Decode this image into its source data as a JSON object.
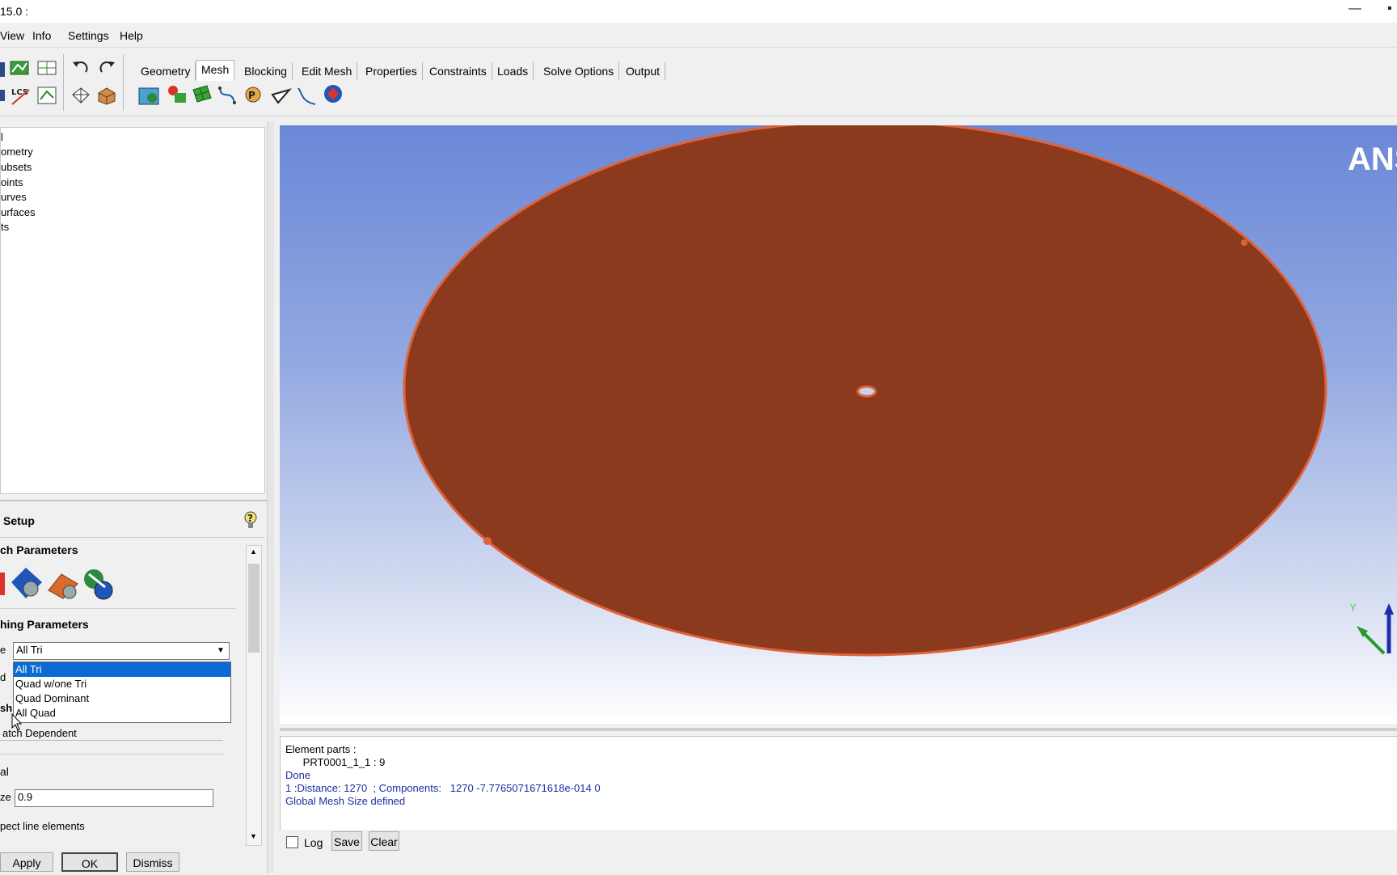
{
  "window": {
    "title": "15.0 :",
    "minimize_glyph": "—",
    "close_glyph": "▪"
  },
  "menu": [
    "View",
    "Info",
    "Settings",
    "Help"
  ],
  "tabs": [
    "Geometry",
    "Mesh",
    "Blocking",
    "Edit Mesh",
    "Properties",
    "Constraints",
    "Loads",
    "Solve Options",
    "Output"
  ],
  "active_tab": "Mesh",
  "toolbar_icons": [
    "save-icon",
    "open-geometry-icon",
    "open-mesh-icon",
    "undo-icon",
    "redo-icon",
    "coordinate-system-icon",
    "measure-icon",
    "view-icon",
    "shade-icon",
    "solid-icon",
    "global-mesh-setup-icon",
    "part-mesh-setup-icon",
    "surface-mesh-setup-icon",
    "curve-mesh-setup-icon",
    "create-periodic-icon",
    "mesh-density-icon",
    "connectors-icon",
    "compute-mesh-icon"
  ],
  "tree": {
    "items": [
      "l",
      "ometry",
      "ubsets",
      "oints",
      "urves",
      "urfaces",
      "ts"
    ]
  },
  "setup": {
    "title": "Setup",
    "help_icon": "help-icon",
    "section1": "ch Parameters",
    "section2": "hing Parameters",
    "mesh_type_label": "e",
    "mesh_type_value": "All Tri",
    "mesh_type_options": [
      "All Tri",
      "Quad w/one Tri",
      "Quad Dominant",
      "All Quad"
    ],
    "selected_option": "All Tri",
    "row2_label": "d",
    "row3_label": "sh",
    "mesh_method_value": "atch Dependent",
    "section3": "al",
    "size_label": "ze",
    "size_value": "0.9",
    "checkbox_label": "pect line elements",
    "buttons": {
      "apply": "Apply",
      "ok": "OK",
      "dismiss": "Dismiss"
    }
  },
  "viewport": {
    "brand_text": "ANS",
    "axis_label": "Y",
    "shape_color": "#8b3a1e",
    "edge_color": "#e0623a",
    "background_top": "#6a88d7",
    "background_bottom": "#ffffff"
  },
  "messages": [
    {
      "text": "Element parts :",
      "color": "#000000"
    },
    {
      "text": "      PRT0001_1_1 : 9",
      "color": "#000000"
    },
    {
      "text": "Done",
      "color": "#1a2fa0"
    },
    {
      "text": "1 :Distance: 1270  ; Components:   1270 -7.7765071671618e-014 0",
      "color": "#1a2fa0"
    },
    {
      "text": "Global Mesh Size defined",
      "color": "#1a2fa0"
    }
  ],
  "bottom": {
    "log_label": "Log",
    "save_label": "Save",
    "clear_label": "Clear"
  }
}
